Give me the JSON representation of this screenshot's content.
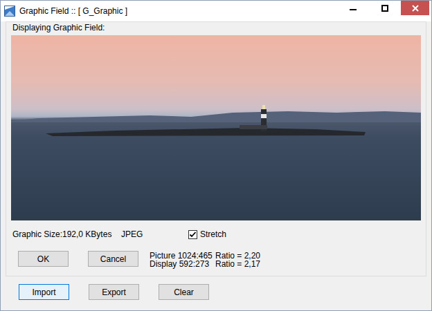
{
  "window": {
    "title": "Graphic Field :: [ G_Graphic ]"
  },
  "group": {
    "label": "Displaying Graphic Field:"
  },
  "info": {
    "size_label": "Graphic Size:",
    "size": "192,0 KBytes",
    "format": "JPEG",
    "stretch": {
      "label": "Stretch",
      "checked": true
    }
  },
  "dialog_buttons": [
    {
      "label": "OK",
      "focused": false
    },
    {
      "label": "Cancel",
      "focused": false
    }
  ],
  "dimensions": [
    {
      "label": "Picture 1024:465",
      "ratio": "Ratio = 2,20"
    },
    {
      "label": "Display 592:273",
      "ratio": "Ratio = 2,17"
    }
  ],
  "bottom_buttons": [
    {
      "label": "Import",
      "focused": true
    },
    {
      "label": "Export",
      "focused": false
    },
    {
      "label": "Clear",
      "focused": false
    }
  ]
}
